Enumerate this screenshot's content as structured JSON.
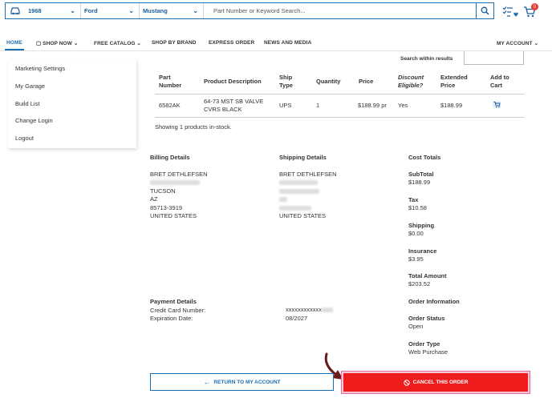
{
  "vehicle": {
    "year": "1968",
    "make": "Ford",
    "model": "Mustang"
  },
  "search": {
    "placeholder": "Part Number or Keyword Search..."
  },
  "cart": {
    "count": "0"
  },
  "nav": {
    "items": [
      "HOME",
      "SHOP NOW",
      "FREE CATALOG",
      "SHOP BY BRAND",
      "EXPRESS ORDER",
      "NEWS AND MEDIA",
      "MY ACCOUNT"
    ]
  },
  "sidebar": {
    "items": [
      "Marketing Settings",
      "My Garage",
      "Build List",
      "Change Login",
      "Logout"
    ]
  },
  "search_within": {
    "label": "Search within results"
  },
  "table": {
    "headers": {
      "part": "Part Number",
      "desc": "Product Description",
      "ship": "Ship Type",
      "qty": "Quantity",
      "price": "Price",
      "discount": "Discount Eligible?",
      "extended": "Extended Price",
      "add": "Add to Cart"
    },
    "rows": [
      {
        "part": "6582AK",
        "desc": "64-73 MST SB VALVE CVRS BLACK",
        "ship": "UPS",
        "qty": "1",
        "price": "$188.99 pr",
        "discount": "Yes",
        "extended": "$188.99"
      }
    ],
    "showing": "Showing 1 products in-stock."
  },
  "billing": {
    "title": "Billing Details",
    "name": "BRET DETHLEFSEN",
    "city": "TUCSON",
    "state": "AZ",
    "zip": "85713-3919",
    "country": "UNITED STATES"
  },
  "shipping": {
    "title": "Shipping Details",
    "name": "BRET DETHLEFSEN",
    "country": "UNITED STATES"
  },
  "payment": {
    "title": "Payment Details",
    "card_label": "Credit Card Number:",
    "card_value": "xxxxxxxxxxxx",
    "exp_label": "Expiration Date:",
    "exp_value": "08/2027"
  },
  "costs": {
    "title": "Cost Totals",
    "subtotal_label": "SubTotal",
    "subtotal": "$188.99",
    "tax_label": "Tax",
    "tax": "$10.58",
    "shipping_label": "Shipping",
    "shipping": "$0.00",
    "insurance_label": "Insurance",
    "insurance": "$3.95",
    "total_label": "Total Amount",
    "total": "$203.52",
    "order_info": "Order Information",
    "status_label": "Order Status",
    "status": "Open",
    "type_label": "Order Type",
    "type": "Web Purchase"
  },
  "buttons": {
    "return": "RETURN TO MY ACCOUNT",
    "cancel": "CANCEL THIS ORDER"
  },
  "colors": {
    "brand_blue": "#1a6fb3",
    "cancel_red": "#ee1c1c"
  }
}
